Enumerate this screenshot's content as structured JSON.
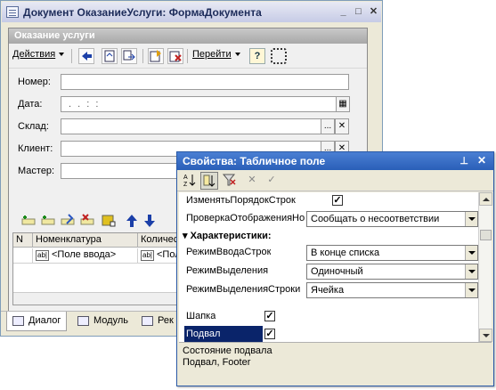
{
  "main_window": {
    "title": "Документ ОказаниеУслуги: ФормаДокумента",
    "form_header": "Оказание услуги",
    "toolbar": {
      "actions_label": "Действия",
      "goto_label": "Перейти",
      "help_label": "?"
    },
    "fields": [
      {
        "label": "Номер:",
        "value": ""
      },
      {
        "label": "Дата:",
        "value": ". .   : :"
      },
      {
        "label": "Склад:",
        "value": ""
      },
      {
        "label": "Клиент:",
        "value": ""
      },
      {
        "label": "Мастер:",
        "value": ""
      }
    ],
    "table": {
      "columns": [
        "N",
        "Номенклатура",
        "Количест"
      ],
      "row": {
        "nomen": "<Поле ввода>",
        "qty": "<Пол",
        "ab1": "ab|",
        "ab2": "ab|"
      }
    },
    "tabs": [
      "Диалог",
      "Модуль",
      "Рек"
    ]
  },
  "properties": {
    "title": "Свойства: Табличное поле",
    "rows": [
      {
        "name": "ИзменятьПорядокСтрок",
        "kind": "check",
        "checked": true
      },
      {
        "name": "ПроверкаОтображенияНовойС",
        "kind": "select",
        "value": "Сообщать о несоответствии"
      }
    ],
    "category": "Характеристики:",
    "char_rows": [
      {
        "name": "РежимВводаСтрок",
        "value": "В конце списка"
      },
      {
        "name": "РежимВыделения",
        "value": "Одиночный"
      },
      {
        "name": "РежимВыделенияСтроки",
        "value": "Ячейка"
      }
    ],
    "check_rows": [
      {
        "name": "Шапка",
        "checked": true
      },
      {
        "name": "Подвал",
        "checked": true
      }
    ],
    "description": {
      "line1": "Состояние подвала",
      "line2": "Подвал, Footer"
    }
  },
  "colors": {
    "selection": "#0a246a",
    "props_title": "#2a5fb8"
  }
}
